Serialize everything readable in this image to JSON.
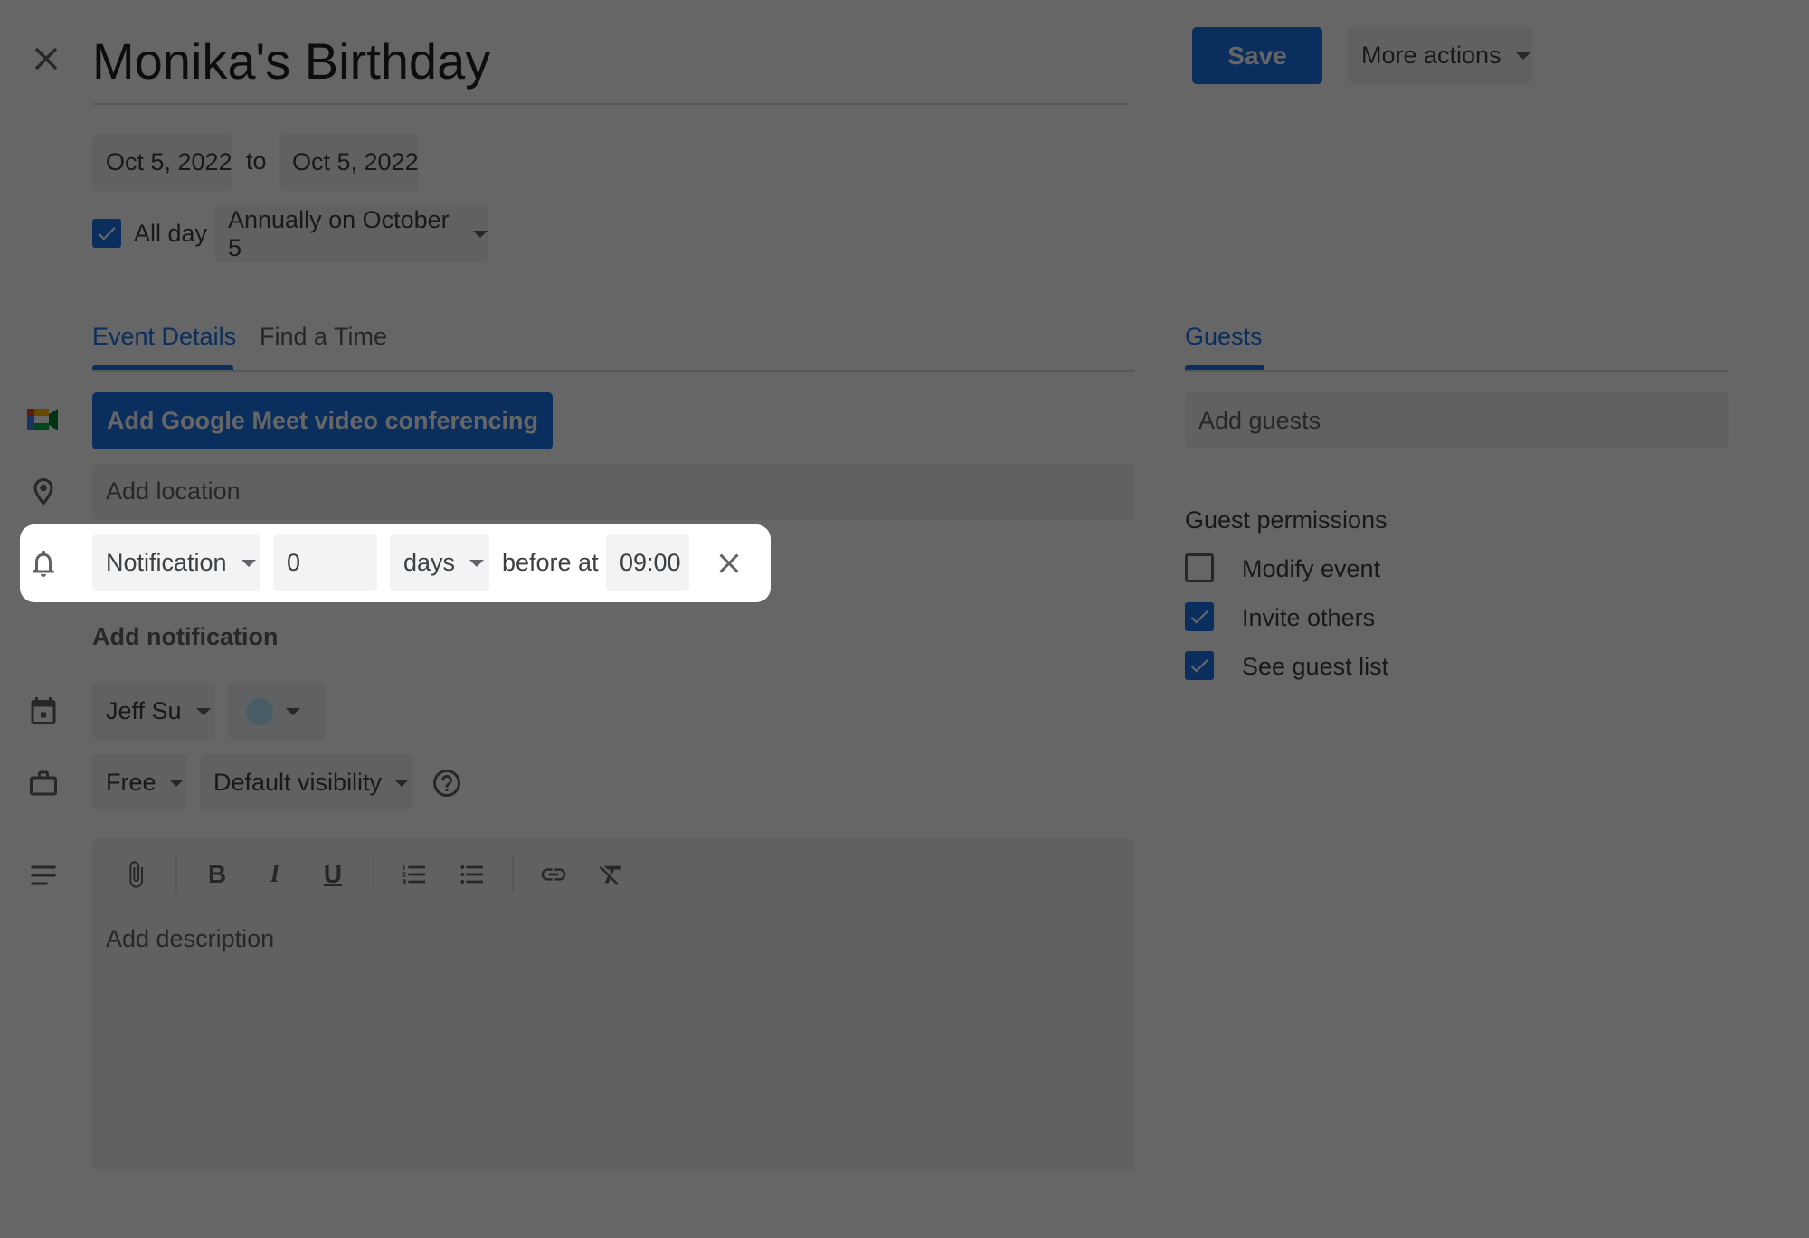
{
  "header": {
    "title": "Monika's Birthday",
    "save_label": "Save",
    "more_actions_label": "More actions"
  },
  "dates": {
    "start": "Oct 5, 2022",
    "to": "to",
    "end": "Oct 5, 2022",
    "all_day_label": "All day",
    "all_day_checked": true,
    "recurrence": "Annually on October 5"
  },
  "tabs": [
    {
      "label": "Event Details",
      "active": true
    },
    {
      "label": "Find a Time",
      "active": false
    }
  ],
  "guests": {
    "tab_label": "Guests",
    "add_placeholder": "Add guests",
    "permissions_title": "Guest permissions",
    "permissions": [
      {
        "label": "Modify event",
        "checked": false
      },
      {
        "label": "Invite others",
        "checked": true
      },
      {
        "label": "See guest list",
        "checked": true
      }
    ]
  },
  "details": {
    "meet_button": "Add Google Meet video conferencing",
    "location_placeholder": "Add location",
    "notification": {
      "type": "Notification",
      "amount": "0",
      "unit": "days",
      "before_at": "before at",
      "time": "09:00"
    },
    "add_notification": "Add notification",
    "calendar_owner": "Jeff Su",
    "availability": "Free",
    "visibility": "Default visibility",
    "description_placeholder": "Add description"
  },
  "colors": {
    "accent": "#1a73e8",
    "meet_green": "#00ac47",
    "meet_blue": "#4285f4",
    "meet_red": "#ea4335",
    "meet_yellow": "#ffba00",
    "event_color": "#b3e5fc"
  }
}
